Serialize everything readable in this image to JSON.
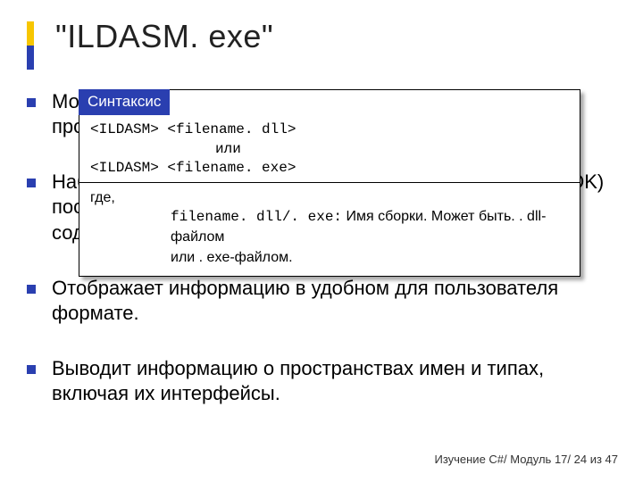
{
  "title": "\"ILDASM. exe\"",
  "bullets": [
    "Модуль — файл, содержащий метаданные типов и код промежуточного языка (Intermediate Language, IL).",
    "Набор инструментов .NET Framework SDK (Framework SDK) поставляется с IL-дизассемблером, который анализирует содержимое управляемых модулей.",
    "Отображает информацию в удобном для пользователя формате.",
    "Выводит информацию о пространствах имен и типах, включая их интерфейсы."
  ],
  "callout": {
    "header": "Синтаксис",
    "line1": "<ILDASM> <filename. dll>",
    "or": "или",
    "line2": "<ILDASM> <filename. exe>",
    "where": "где,",
    "desc_prefix": "filename. dll/. exe:",
    "desc_text": " Имя сборки. Может быть. . dll-файлом",
    "desc_text2": "или  . exe-файлом."
  },
  "footer": "Изучение C#/ Модуль 17/ 24 из 47"
}
